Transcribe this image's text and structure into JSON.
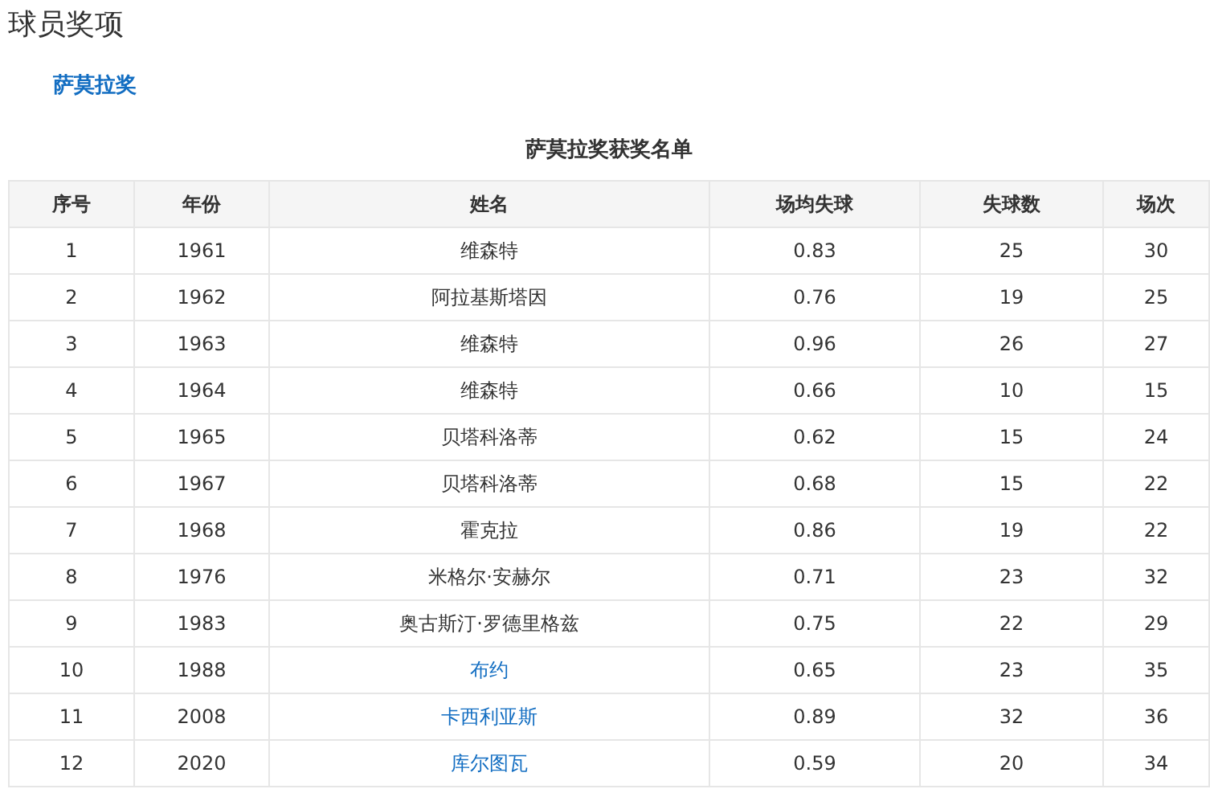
{
  "page_title": "球员奖项",
  "section_link": "萨莫拉奖",
  "table": {
    "caption": "萨莫拉奖获奖名单",
    "columns": [
      "序号",
      "年份",
      "姓名",
      "场均失球",
      "失球数",
      "场次"
    ],
    "rows": [
      {
        "cells": [
          "1",
          "1961",
          "维森特",
          "0.83",
          "25",
          "30"
        ],
        "name_link": false
      },
      {
        "cells": [
          "2",
          "1962",
          "阿拉基斯塔因",
          "0.76",
          "19",
          "25"
        ],
        "name_link": false
      },
      {
        "cells": [
          "3",
          "1963",
          "维森特",
          "0.96",
          "26",
          "27"
        ],
        "name_link": false
      },
      {
        "cells": [
          "4",
          "1964",
          "维森特",
          "0.66",
          "10",
          "15"
        ],
        "name_link": false
      },
      {
        "cells": [
          "5",
          "1965",
          "贝塔科洛蒂",
          "0.62",
          "15",
          "24"
        ],
        "name_link": false
      },
      {
        "cells": [
          "6",
          "1967",
          "贝塔科洛蒂",
          "0.68",
          "15",
          "22"
        ],
        "name_link": false
      },
      {
        "cells": [
          "7",
          "1968",
          "霍克拉",
          "0.86",
          "19",
          "22"
        ],
        "name_link": false
      },
      {
        "cells": [
          "8",
          "1976",
          "米格尔·安赫尔",
          "0.71",
          "23",
          "32"
        ],
        "name_link": false
      },
      {
        "cells": [
          "9",
          "1983",
          "奥古斯汀·罗德里格兹",
          "0.75",
          "22",
          "29"
        ],
        "name_link": false
      },
      {
        "cells": [
          "10",
          "1988",
          "布约",
          "0.65",
          "23",
          "35"
        ],
        "name_link": true
      },
      {
        "cells": [
          "11",
          "2008",
          "卡西利亚斯",
          "0.89",
          "32",
          "36"
        ],
        "name_link": true
      },
      {
        "cells": [
          "12",
          "2020",
          "库尔图瓦",
          "0.59",
          "20",
          "34"
        ],
        "name_link": true
      }
    ]
  }
}
